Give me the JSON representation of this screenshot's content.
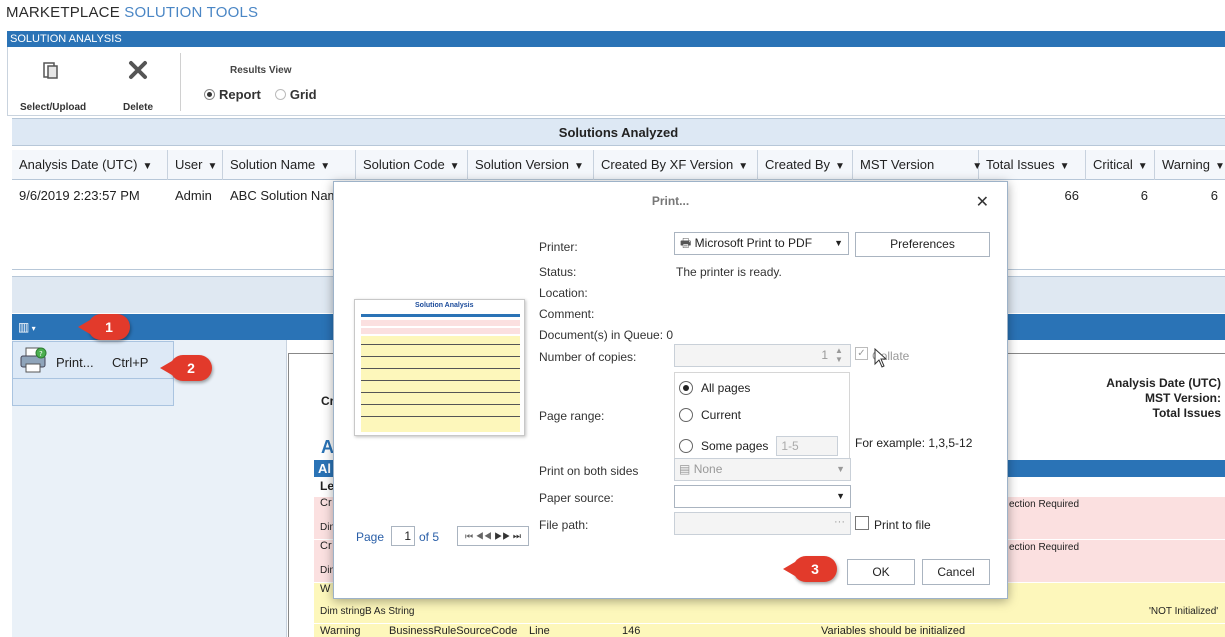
{
  "app": {
    "title_part1": "MARKETPLACE",
    "title_part2": "SOLUTION TOOLS"
  },
  "section": {
    "label": "SOLUTION ANALYSIS"
  },
  "toolbar": {
    "select_upload_label": "Select/Upload",
    "delete_label": "Delete",
    "results_view_title": "Results View",
    "report_option": "Report",
    "grid_option": "Grid",
    "selected_view": "Report"
  },
  "grid": {
    "title": "Solutions Analyzed",
    "columns": [
      "Analysis Date (UTC)",
      "User",
      "Solution Name",
      "Solution Code",
      "Solution Version",
      "Created By XF Version",
      "Created By",
      "MST Version",
      "Total Issues",
      "Critical",
      "Warning"
    ],
    "row": {
      "analysis_date": "9/6/2019 2:23:57 PM",
      "user": "Admin",
      "solution_name": "ABC Solution Nam",
      "total_issues": "66",
      "critical": "6",
      "warning": "6"
    }
  },
  "print_menu": {
    "label": "Print...",
    "shortcut": "Ctrl+P"
  },
  "report": {
    "analysis_date_label": "Analysis Date (UTC)",
    "mst_version_label": "MST Version:",
    "total_issues_label": "Total Issues",
    "cr_label": "Cr",
    "a_label": "A",
    "al_label": "Al",
    "le_label": "Le",
    "row_cr1": "Cr",
    "row_dim1": "Dim",
    "row_cr2": "Cr",
    "row_dim2": "Dim",
    "row_w": "W",
    "row_dim3": "Dim stringB As String",
    "action_required_1": "ection Required",
    "action_required_2": "ection Required",
    "not_initialized": "'NOT Initialized'",
    "bottom_type": "Warning",
    "bottom_source": "BusinessRuleSourceCode",
    "bottom_line_label": "Line",
    "bottom_line": "146",
    "bottom_message": "Variables should be initialized"
  },
  "dialog": {
    "title": "Print...",
    "printer_label": "Printer:",
    "printer_value": "Microsoft Print to PDF",
    "preferences_button": "Preferences",
    "status_label": "Status:",
    "status_value": "The printer is ready.",
    "location_label": "Location:",
    "comment_label": "Comment:",
    "queue_label": "Document(s) in Queue:",
    "queue_value": "0",
    "copies_label": "Number of copies:",
    "copies_value": "1",
    "collate_label": "Collate",
    "page_range_label": "Page range:",
    "all_pages": "All pages",
    "current": "Current",
    "some_pages": "Some pages",
    "some_pages_value": "1-5",
    "example": "For example: 1,3,5-12",
    "both_sides_label": "Print on both sides",
    "both_sides_value": "None",
    "paper_source_label": "Paper source:",
    "file_path_label": "File path:",
    "file_path_ellipsis": "···",
    "print_to_file": "Print to file",
    "page_label": "Page",
    "page_value": "1",
    "of_pages": "of 5",
    "ok_button": "OK",
    "cancel_button": "Cancel"
  },
  "thumbnail": {
    "title": "Solution Analysis"
  },
  "callouts": {
    "one": "1",
    "two": "2",
    "three": "3"
  },
  "colors": {
    "accent": "#2a73b6",
    "callout": "#e23a2b",
    "critical_row": "#fbe0e0",
    "warning_row": "#fdf7bb"
  }
}
